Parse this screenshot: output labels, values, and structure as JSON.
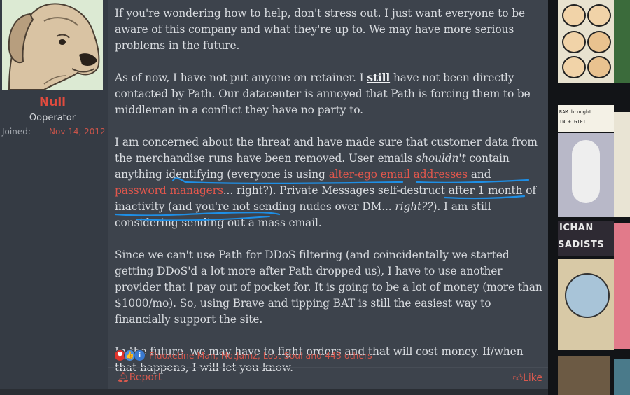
{
  "user": {
    "name": "Null",
    "title": "Ooperator",
    "joined_label": "Joined:",
    "joined_value": "Nov 14, 2012"
  },
  "post": {
    "p1": "If you're wondering how to help, don't stress out. I just want everyone to be aware of this company and what they're up to. We may have more serious problems in the future.",
    "p2_a": "As of now, I have not put anyone on retainer. I ",
    "p2_bold": "still",
    "p2_b": " have not been directly contacted by Path. Our datacenter is annoyed that Path is forcing them to be middleman in a conflict they have no party to.",
    "p3_a": "I am concerned about the threat and have made sure that customer data from the merchandise runs have been removed. User emails ",
    "p3_em": "shouldn't",
    "p3_b": " contain anything identifying (everyone is using ",
    "p3_link1": "alter-ego email addresses",
    "p3_c": " and ",
    "p3_link2": "password managers",
    "p3_d": "... right?). Private Messages self-destruct after 1 month of inactivity (and you're not sending nudes over DM... ",
    "p3_em2": "right??",
    "p3_e": "). I am still considering sending out a mass email.",
    "p4": "Since we can't use Path for DDoS filtering (and coincidentally we started getting DDoS'd a lot more after Path dropped us), I have to use another provider that I pay out of pocket for. It is going to be a lot of money (more than $1000/mo). So, using Brave and tipping BAT is still the easiest way to financially support the site.",
    "p5": "In the future, we may have to fight orders and that will cost money. If/when that happens, I will let you know."
  },
  "reactions": {
    "names": "Fluoxetine Man, HotJamz, Lost Soul and 443 others",
    "icons": [
      "heart-icon",
      "thumbs-up-icon",
      "info-icon"
    ]
  },
  "footer": {
    "report_label": "Report",
    "like_label": "Like"
  },
  "collage": {
    "text1": "ICHAN",
    "text2": "SADISTS",
    "text3": "RAM brought",
    "text4": "IN + GIFT"
  },
  "colors": {
    "accent": "#e04b3e",
    "annotation": "#1e8fe6",
    "post_bg": "#3d434c",
    "user_bg": "#353b44"
  }
}
